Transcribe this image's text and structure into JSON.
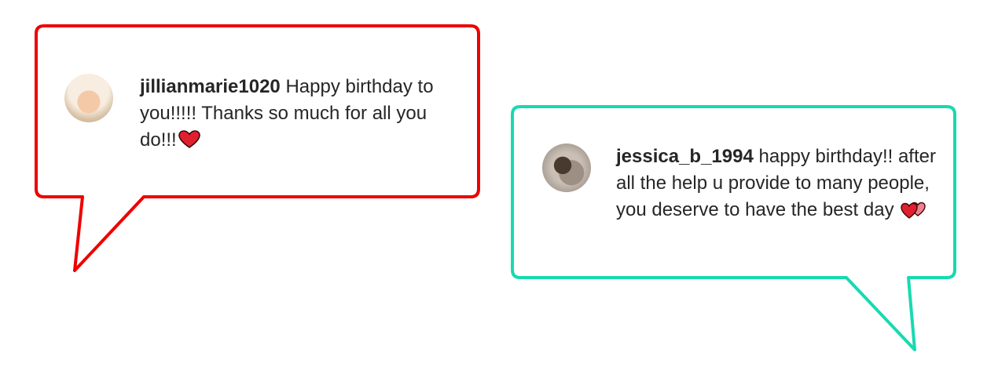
{
  "colors": {
    "bubble_left_border": "#ee0000",
    "bubble_right_border": "#19d9b0",
    "text": "#262626",
    "heart": "#e0202e"
  },
  "comments": [
    {
      "username": "jillianmarie1020",
      "text": "Happy birthday to you!!!!! Thanks so much for all you do!!!",
      "emoji": "red-heart-icon"
    },
    {
      "username": "jessica_b_1994",
      "text": "happy birthday!! after all the help u provide to many people, you deserve to have the best day",
      "emoji": "two-hearts-icon"
    }
  ]
}
